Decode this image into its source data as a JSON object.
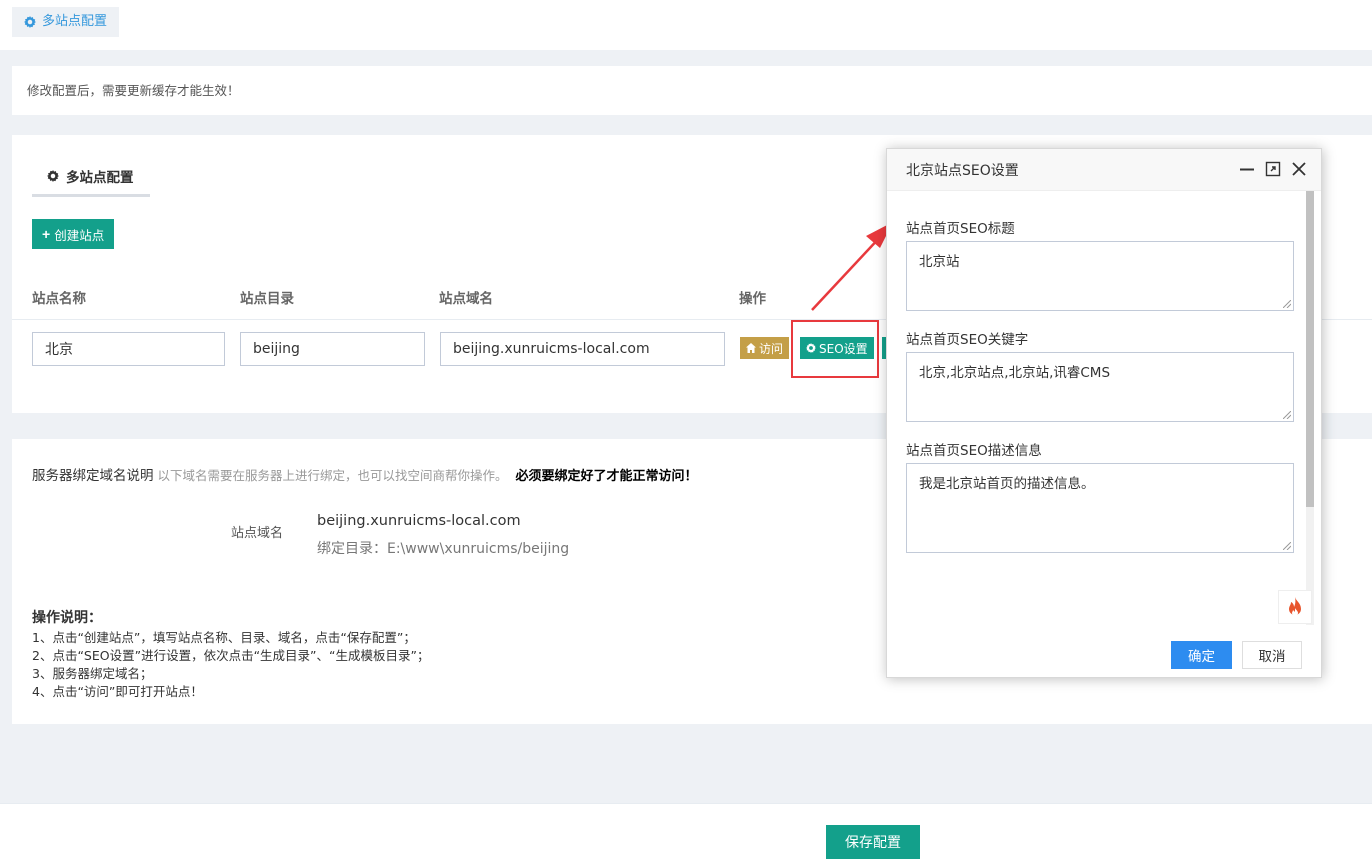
{
  "breadcrumb": {
    "label": "多站点配置",
    "icon": "gear-icon"
  },
  "notice": {
    "text": "修改配置后，需要更新缓存才能生效！"
  },
  "panel": {
    "tab_label": "多站点配置",
    "create_button": "创建站点",
    "columns": [
      "站点名称",
      "站点目录",
      "站点域名",
      "操作"
    ],
    "row": {
      "name": "北京",
      "dir": "beijing",
      "domain": "beijing.xunruicms-local.com",
      "visit_label": "访问",
      "seo_label": "SEO设置"
    }
  },
  "binding": {
    "title": "服务器绑定域名说明",
    "hint": "以下域名需要在服务器上进行绑定，也可以找空间商帮你操作。",
    "warning": "必须要绑定好了才能正常访问！",
    "domain_label": "站点域名",
    "domain_value": "beijing.xunruicms-local.com",
    "bind_dir": "绑定目录：E:\\www\\xunruicms/beijing"
  },
  "instructions": {
    "heading": "操作说明：",
    "steps": [
      "1、点击“创建站点”，填写站点名称、目录、域名，点击“保存配置”；",
      "2、点击“SEO设置”进行设置，依次点击“生成目录”、“生成模板目录”；",
      "3、服务器绑定域名；",
      "4、点击“访问”即可打开站点！"
    ]
  },
  "footer": {
    "save_label": "保存配置"
  },
  "dialog": {
    "title": "北京站点SEO设置",
    "fields": [
      {
        "label": "站点首页SEO标题",
        "value": "北京站"
      },
      {
        "label": "站点首页SEO关键字",
        "value": "北京,北京站点,北京站,讯睿CMS"
      },
      {
        "label": "站点首页SEO描述信息",
        "value": "我是北京站首页的描述信息。"
      }
    ],
    "ok_label": "确定",
    "cancel_label": "取消"
  },
  "colors": {
    "primary": "#13a08b",
    "visit": "#c49f47",
    "ok": "#2d8cf0",
    "annotation": "#e8393d",
    "link": "#3598dc"
  }
}
